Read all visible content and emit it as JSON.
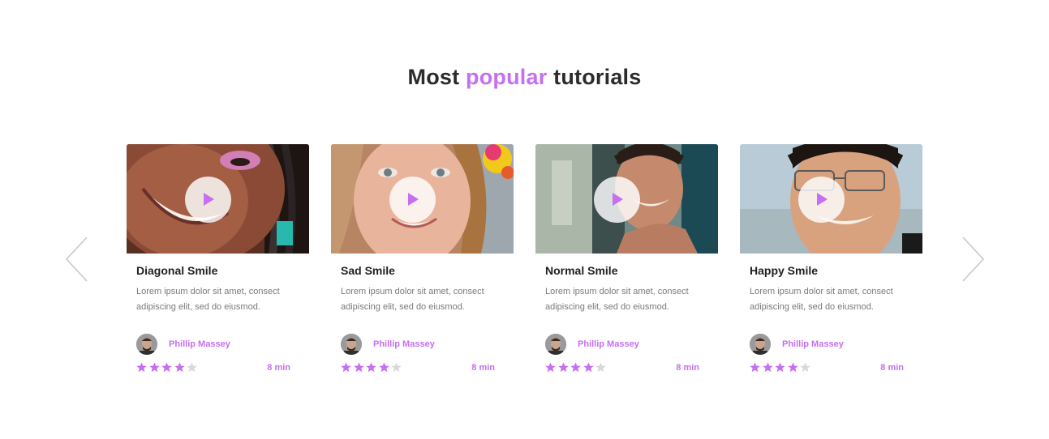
{
  "heading": {
    "before": "Most",
    "accent": "popular",
    "after": "tutorials"
  },
  "colors": {
    "accent": "#c66ff0",
    "star_empty": "#d9d9d9",
    "arrow": "#c8c8c8"
  },
  "navigation": {
    "prev_icon": "chevron-left-icon",
    "next_icon": "chevron-right-icon"
  },
  "cards": [
    {
      "title": "Diagonal Smile",
      "description": "Lorem ipsum dolor sit amet, consect adipiscing elit, sed do eiusmod.",
      "author": "Phillip Massey",
      "rating": 4,
      "rating_max": 5,
      "duration": "8 min"
    },
    {
      "title": "Sad Smile",
      "description": "Lorem ipsum dolor sit amet, consect adipiscing elit, sed do eiusmod.",
      "author": "Phillip Massey",
      "rating": 4,
      "rating_max": 5,
      "duration": "8 min"
    },
    {
      "title": "Normal Smile",
      "description": "Lorem ipsum dolor sit amet, consect adipiscing elit, sed do eiusmod.",
      "author": "Phillip Massey",
      "rating": 4,
      "rating_max": 5,
      "duration": "8 min"
    },
    {
      "title": "Happy Smile",
      "description": "Lorem ipsum dolor sit amet, consect adipiscing elit, sed do eiusmod.",
      "author": "Phillip Massey",
      "rating": 4,
      "rating_max": 5,
      "duration": "8 min"
    }
  ]
}
